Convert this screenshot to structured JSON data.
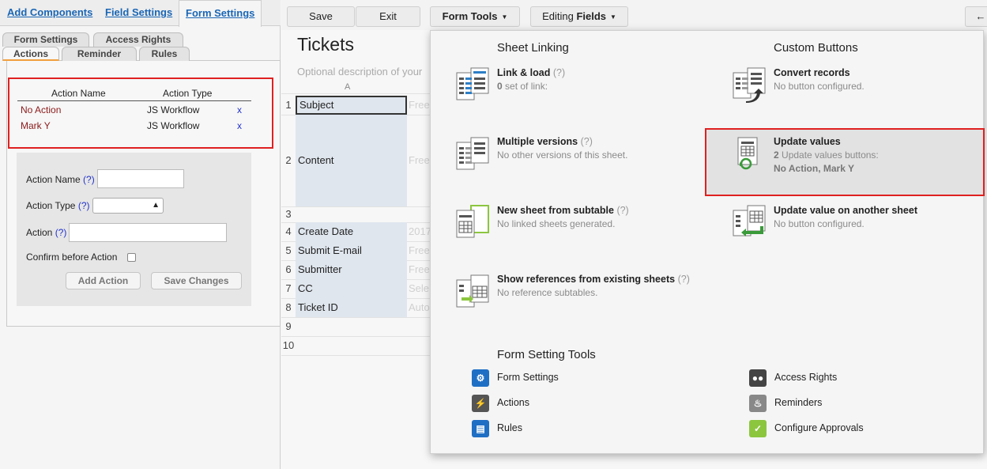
{
  "left": {
    "top_tabs": [
      "Add Components",
      "Field Settings",
      "Form Settings"
    ],
    "sub_tabs_row1": [
      "Form Settings",
      "Access Rights"
    ],
    "sub_tabs_row2": [
      "Actions",
      "Reminder",
      "Rules"
    ],
    "actions_table": {
      "headers": [
        "Action Name",
        "Action Type"
      ],
      "rows": [
        {
          "name": "No Action",
          "type": "JS Workflow",
          "delete": "x"
        },
        {
          "name": "Mark Y",
          "type": "JS Workflow",
          "delete": "x"
        }
      ]
    },
    "form": {
      "action_name_label": "Action Name",
      "action_type_label": "Action Type",
      "action_label": "Action",
      "help": "(?)",
      "confirm_label": "Confirm before Action",
      "action_type_value": "",
      "add_button": "Add Action",
      "save_button": "Save Changes"
    }
  },
  "toolbar": {
    "save": "Save",
    "exit": "Exit",
    "form_tools": "Form Tools",
    "editing": "Editing",
    "fields": "Fields",
    "back_arrow": "←"
  },
  "sheet": {
    "title": "Tickets",
    "description": "Optional description of your",
    "column_header": "A",
    "rows": [
      {
        "num": "1",
        "field": "Subject",
        "placeholder": "Free"
      },
      {
        "num": "2",
        "field": "Content",
        "placeholder": "Free"
      },
      {
        "num": "3",
        "field": "",
        "placeholder": ""
      },
      {
        "num": "4",
        "field": "Create Date",
        "placeholder": "2017"
      },
      {
        "num": "5",
        "field": "Submit E-mail",
        "placeholder": "Free"
      },
      {
        "num": "6",
        "field": "Submitter",
        "placeholder": "Free"
      },
      {
        "num": "7",
        "field": "CC",
        "placeholder": "Sele"
      },
      {
        "num": "8",
        "field": "Ticket ID",
        "placeholder": "Auto"
      },
      {
        "num": "9",
        "field": "",
        "placeholder": ""
      },
      {
        "num": "10",
        "field": "",
        "placeholder": ""
      }
    ]
  },
  "dropdown": {
    "sheet_linking_title": "Sheet Linking",
    "custom_buttons_title": "Custom Buttons",
    "form_setting_tools_title": "Form Setting Tools",
    "help": "(?)",
    "link_load": {
      "title": "Link & load",
      "count": "0",
      "desc": " set of link:"
    },
    "multiple_versions": {
      "title": "Multiple versions",
      "desc": "No other versions of this sheet."
    },
    "new_sheet": {
      "title": "New sheet from subtable",
      "desc": "No linked sheets generated."
    },
    "show_refs": {
      "title": "Show references from existing sheets",
      "desc": "No reference subtables."
    },
    "convert": {
      "title": "Convert records",
      "desc": "No button configured."
    },
    "update_values": {
      "title": "Update values",
      "count": "2",
      "desc": " Update values buttons:",
      "names": "No Action, Mark Y"
    },
    "update_other": {
      "title": "Update value on another sheet",
      "desc": "No button configured."
    },
    "tools": {
      "form_settings": "Form Settings",
      "actions": "Actions",
      "rules": "Rules",
      "access_rights": "Access Rights",
      "reminders": "Reminders",
      "configure_approvals": "Configure Approvals"
    }
  },
  "colors": {
    "link_blue": "#1a66b5",
    "highlight_red": "#e02020",
    "action_name_red": "#8b1a1a",
    "approvals_green": "#8cc63f",
    "form_settings_blue": "#1f6fc5"
  },
  "icons": {
    "form_settings": "gear-icon",
    "actions": "lightning-icon",
    "rules": "book-icon",
    "access_rights": "users-icon",
    "reminders": "bell-icon",
    "configure_approvals": "check-icon"
  }
}
